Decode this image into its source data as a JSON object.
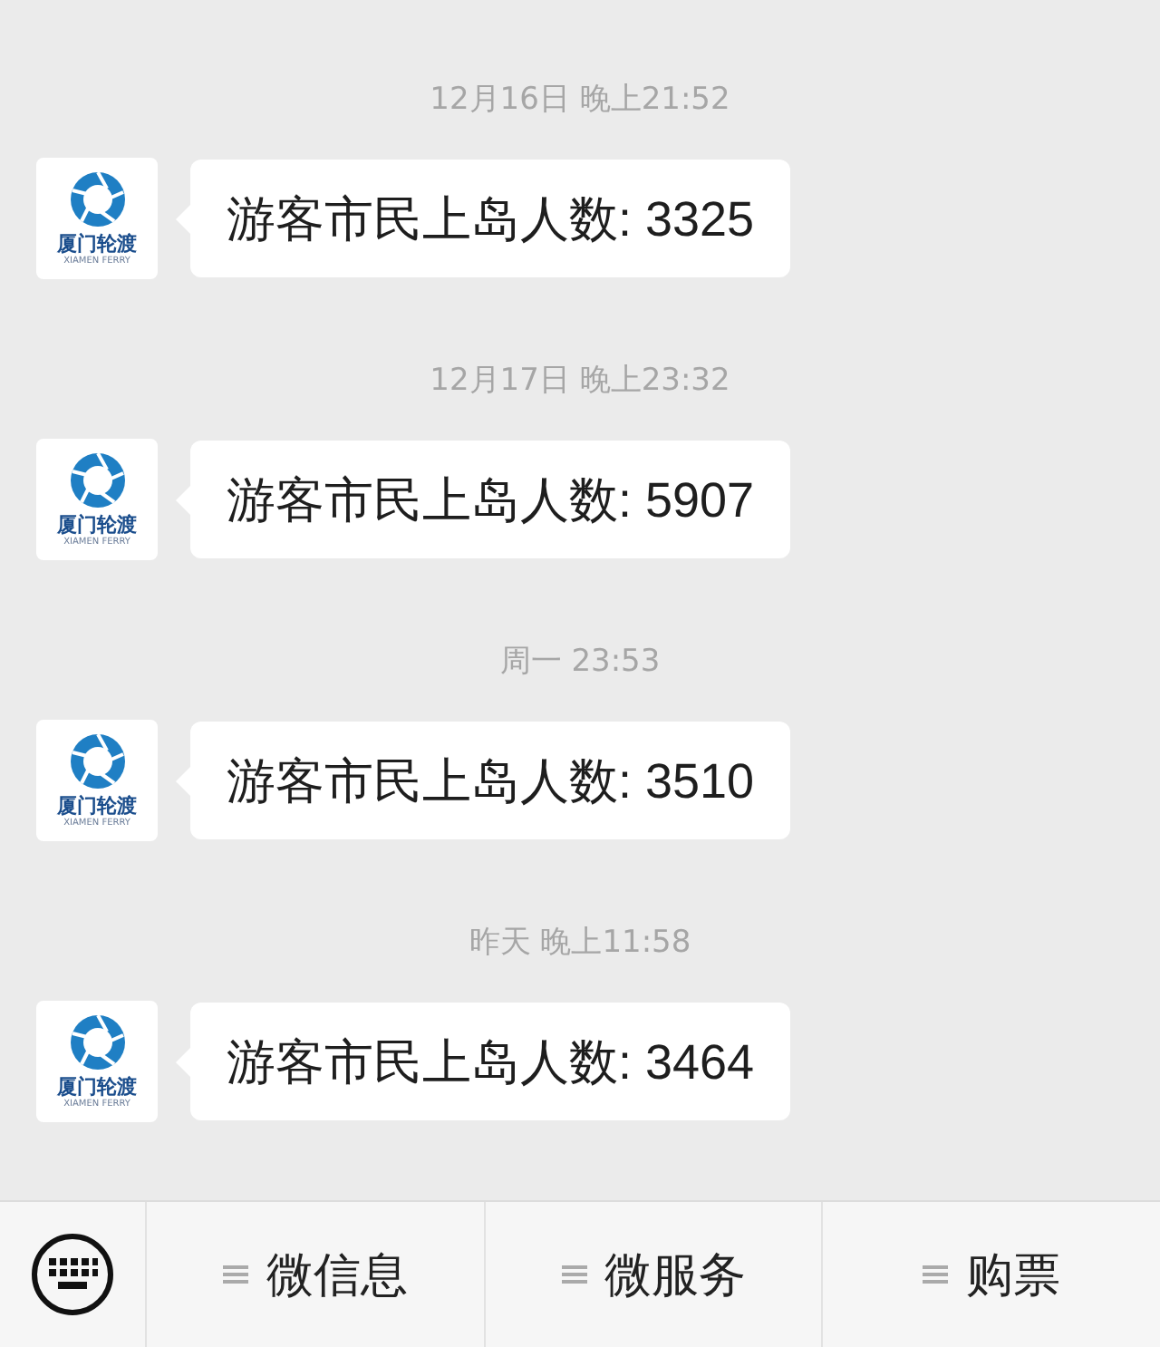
{
  "messages": [
    {
      "time": "12月16日 晚上21:52",
      "avatar": {
        "name": "厦门轮渡",
        "subtitle": "XIAMEN FERRY"
      },
      "text": "游客市民上岛人数: 3325"
    },
    {
      "time": "12月17日 晚上23:32",
      "avatar": {
        "name": "厦门轮渡",
        "subtitle": "XIAMEN FERRY"
      },
      "text": "游客市民上岛人数: 5907"
    },
    {
      "time": "周一 23:53",
      "avatar": {
        "name": "厦门轮渡",
        "subtitle": "XIAMEN FERRY"
      },
      "text": "游客市民上岛人数: 3510"
    },
    {
      "time": "昨天 晚上11:58",
      "avatar": {
        "name": "厦门轮渡",
        "subtitle": "XIAMEN FERRY"
      },
      "text": "游客市民上岛人数: 3464"
    }
  ],
  "menu": [
    "微信息",
    "微服务",
    "购票"
  ]
}
